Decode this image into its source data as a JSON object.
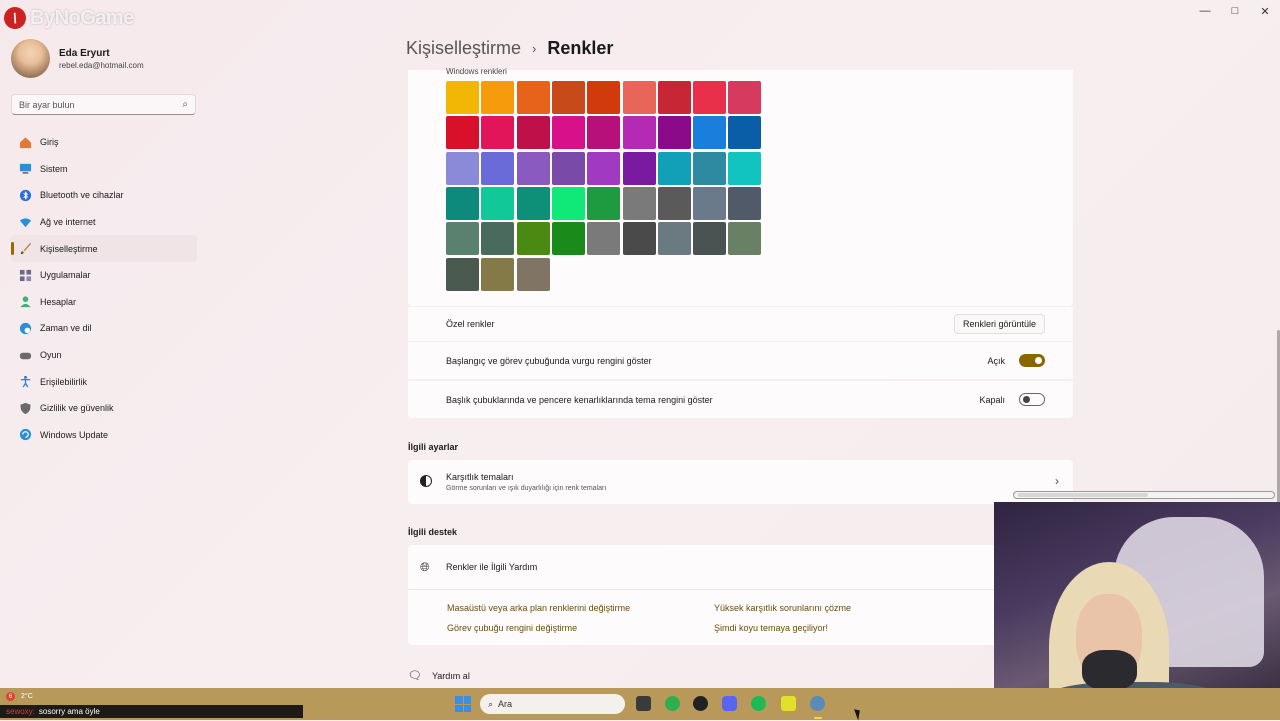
{
  "watermark": {
    "brand_text": "ByNoGame"
  },
  "window": {
    "controls": [
      "—",
      "□",
      "✕"
    ]
  },
  "profile": {
    "name": "Eda Eryurt",
    "email": "rebel.eda@hotmail.com"
  },
  "search": {
    "placeholder": "Bir ayar bulun"
  },
  "sidebar": {
    "items": [
      {
        "label": "Giriş",
        "icon": "home-icon",
        "color": "#e07a3a",
        "active": false
      },
      {
        "label": "Sistem",
        "icon": "monitor-icon",
        "color": "#2a8fd8",
        "active": false
      },
      {
        "label": "Bluetooth ve cihazlar",
        "icon": "bluetooth-icon",
        "color": "#2a6fd8",
        "active": false
      },
      {
        "label": "Ağ ve internet",
        "icon": "wifi-icon",
        "color": "#2a8fd8",
        "active": false
      },
      {
        "label": "Kişiselleştirme",
        "icon": "brush-icon",
        "color": "#b8842a",
        "active": true
      },
      {
        "label": "Uygulamalar",
        "icon": "apps-icon",
        "color": "#6a6a8a",
        "active": false
      },
      {
        "label": "Hesaplar",
        "icon": "person-icon",
        "color": "#3ab07a",
        "active": false
      },
      {
        "label": "Zaman ve dil",
        "icon": "globe-clock-icon",
        "color": "#2a8fd8",
        "active": false
      },
      {
        "label": "Oyun",
        "icon": "gamepad-icon",
        "color": "#6a6a6a",
        "active": false
      },
      {
        "label": "Erişilebilirlik",
        "icon": "accessibility-icon",
        "color": "#2a7fd8",
        "active": false
      },
      {
        "label": "Gizlilik ve güvenlik",
        "icon": "shield-icon",
        "color": "#6a6a6a",
        "active": false
      },
      {
        "label": "Windows Update",
        "icon": "update-icon",
        "color": "#2a8fd8",
        "active": false
      }
    ]
  },
  "breadcrumb": {
    "parent": "Kişiselleştirme",
    "separator": "›",
    "current": "Renkler"
  },
  "colors": {
    "label": "Windows renkleri",
    "rows": [
      [
        "#f2b705",
        "#f59b0c",
        "#e8631a",
        "#c64a1a",
        "#d13a0a",
        "#e8655a",
        "#c72735",
        "#e8304a",
        "#d63a5e"
      ],
      [
        "#d8102a",
        "#e2145a",
        "#c0104a",
        "#d8108a",
        "#b8107a",
        "#b42ab4",
        "#8a0a8a",
        "#1a7fdc",
        "#0a5ea8"
      ],
      [
        "#8a8ad8",
        "#6a6ad8",
        "#8a5ac0",
        "#7a4aa8",
        "#a03ac0",
        "#7a1aa0",
        "#12a0b8",
        "#2e8aa0",
        "#12c4c0"
      ],
      [
        "#0e8a7a",
        "#10c898",
        "#0e9078",
        "#10e878",
        "#1e9a40",
        "#7a7a7a",
        "#5a5a5a",
        "#6a7a8a",
        "#505a68"
      ],
      [
        "#5a8070",
        "#4a6a5e",
        "#4a8a12",
        "#1a8a1a",
        "#7a7a7a",
        "#4a4a4a",
        "#6a7a80",
        "#4a5252",
        "#6a8064"
      ],
      [
        "#4a5a50",
        "#847a48",
        "#807464"
      ]
    ]
  },
  "custom": {
    "label": "Özel renkler",
    "button": "Renkleri görüntüle"
  },
  "accent_start": {
    "label": "Başlangıç ve görev çubuğunda vurgu rengini göster",
    "state": "Açık",
    "on": true
  },
  "accent_title": {
    "label": "Başlık çubuklarında ve pencere kenarlıklarında tema rengini göster",
    "state": "Kapalı",
    "on": false
  },
  "related_settings": {
    "heading": "İlgili ayarlar",
    "contrast": {
      "title": "Karşıtlık temaları",
      "desc": "Görme sorunları ve ışık duyarlılığı için renk temaları"
    }
  },
  "related_support": {
    "heading": "İlgili destek",
    "title": "Renkler ile İlgili Yardım",
    "links": [
      "Masaüstü veya arka plan renklerini değiştirme",
      "Yüksek karşıtlık sorunlarını çözme",
      "Görev çubuğu rengini değiştirme",
      "Şimdi koyu temaya geçiliyor!"
    ]
  },
  "help": {
    "label": "Yardım al"
  },
  "taskbar": {
    "weather": "2°C",
    "weather_badge": "6",
    "search_placeholder": "Ara",
    "chat_user": "sewoxy:",
    "chat_message": "sosorry ama öyle"
  }
}
